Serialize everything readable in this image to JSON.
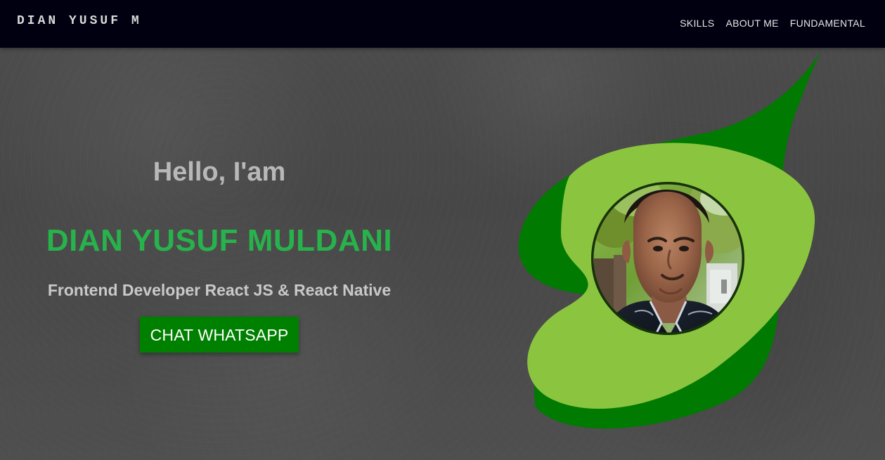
{
  "navbar": {
    "brand": "DIAN YUSUF M",
    "links": [
      "SKILLS",
      "ABOUT ME",
      "FUNDAMENTAL"
    ]
  },
  "hero": {
    "greeting": "Hello, I'am",
    "name": "DIAN YUSUF MULDANI",
    "role": "Frontend Developer React JS & React Native",
    "cta_label": "CHAT WHATSAPP"
  },
  "colors": {
    "navbar_bg": "#000011",
    "text_gray": "#b8b8b8",
    "accent_green": "#28b24b",
    "button_green": "#008000",
    "shape_dark_green": "#007a00",
    "shape_light_green": "#8bc53f"
  },
  "icons": {
    "portrait": "profile-photo"
  }
}
